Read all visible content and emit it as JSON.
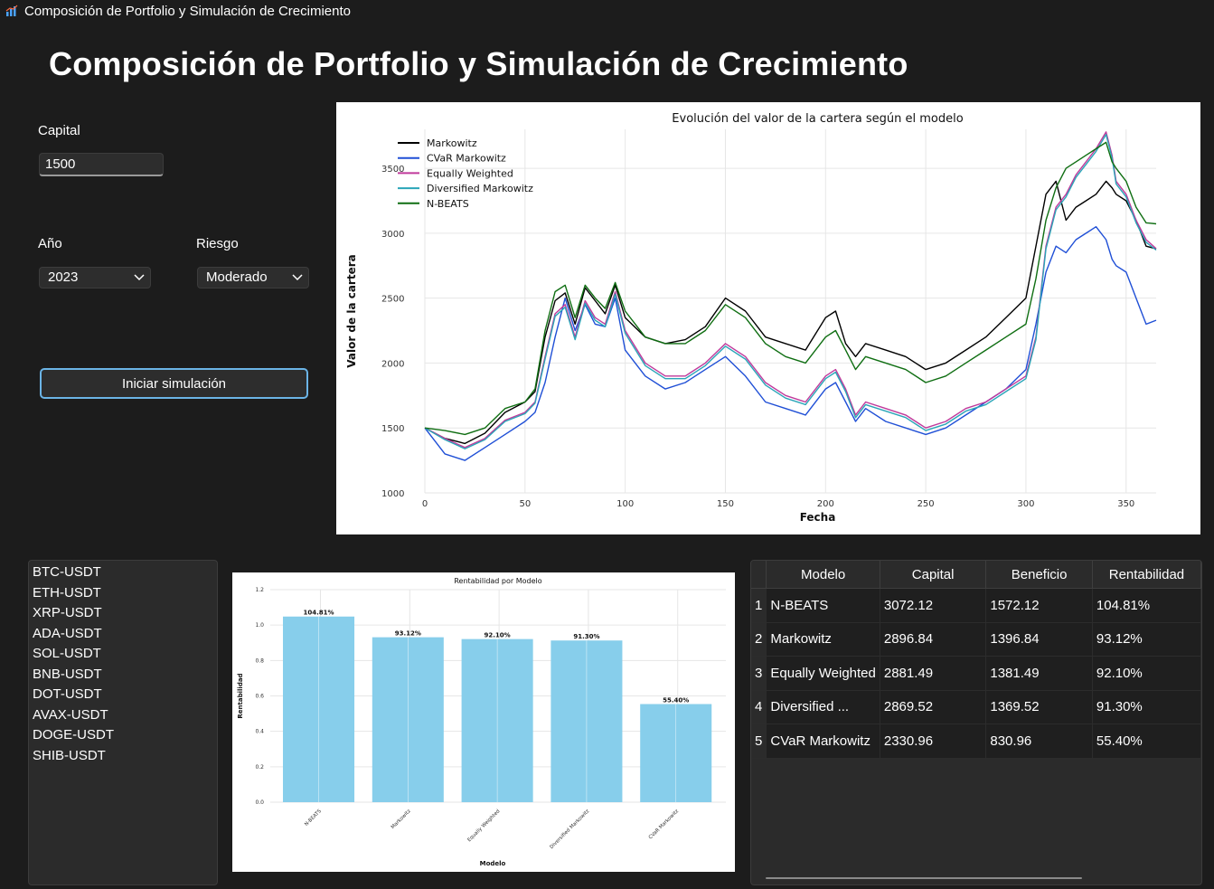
{
  "window": {
    "title": "Composición de Portfolio y Simulación de Crecimiento"
  },
  "header": {
    "title": "Composición de Portfolio y Simulación de Crecimiento"
  },
  "form": {
    "capital_label": "Capital",
    "capital_value": "1500",
    "year_label": "Año",
    "year_value": "2023",
    "risk_label": "Riesgo",
    "risk_value": "Moderado",
    "start_button": "Iniciar simulación"
  },
  "tickers": [
    "BTC-USDT",
    "ETH-USDT",
    "XRP-USDT",
    "ADA-USDT",
    "SOL-USDT",
    "BNB-USDT",
    "DOT-USDT",
    "AVAX-USDT",
    "DOGE-USDT",
    "SHIB-USDT"
  ],
  "results_table": {
    "columns": [
      "Modelo",
      "Capital",
      "Beneficio",
      "Rentabilidad"
    ],
    "rows": [
      {
        "index": "1",
        "model": "N-BEATS",
        "capital": "3072.12",
        "benefit": "1572.12",
        "return": "104.81%"
      },
      {
        "index": "2",
        "model": "Markowitz",
        "capital": "2896.84",
        "benefit": "1396.84",
        "return": "93.12%"
      },
      {
        "index": "3",
        "model": "Equally Weighted",
        "capital": "2881.49",
        "benefit": "1381.49",
        "return": "92.10%"
      },
      {
        "index": "4",
        "model": "Diversified ...",
        "capital": "2869.52",
        "benefit": "1369.52",
        "return": "91.30%"
      },
      {
        "index": "5",
        "model": "CVaR Markowitz",
        "capital": "2330.96",
        "benefit": "830.96",
        "return": "55.40%"
      }
    ]
  },
  "chart_data": [
    {
      "type": "line",
      "title": "Evolución del valor de la cartera según el modelo",
      "xlabel": "Fecha",
      "ylabel": "Valor de la cartera",
      "xlim": [
        0,
        365
      ],
      "ylim": [
        1000,
        3800
      ],
      "xticks": [
        0,
        50,
        100,
        150,
        200,
        250,
        300,
        350
      ],
      "yticks": [
        1000,
        1500,
        2000,
        2500,
        3000,
        3500
      ],
      "grid": true,
      "legend_position": "top-left",
      "x": [
        0,
        10,
        20,
        30,
        40,
        50,
        55,
        60,
        65,
        70,
        75,
        80,
        85,
        90,
        95,
        100,
        110,
        120,
        130,
        140,
        150,
        160,
        170,
        180,
        190,
        200,
        205,
        210,
        215,
        220,
        230,
        240,
        250,
        260,
        270,
        280,
        290,
        300,
        305,
        310,
        315,
        320,
        325,
        330,
        335,
        340,
        343,
        345,
        350,
        355,
        360,
        365
      ],
      "series": [
        {
          "name": "Markowitz",
          "color": "#000000",
          "values": [
            1500,
            1420,
            1380,
            1460,
            1620,
            1700,
            1780,
            2200,
            2480,
            2540,
            2300,
            2580,
            2480,
            2380,
            2600,
            2350,
            2200,
            2150,
            2180,
            2280,
            2500,
            2400,
            2200,
            2150,
            2100,
            2350,
            2400,
            2150,
            2050,
            2150,
            2100,
            2050,
            1950,
            2000,
            2100,
            2200,
            2350,
            2500,
            2900,
            3300,
            3400,
            3100,
            3200,
            3250,
            3300,
            3400,
            3350,
            3300,
            3250,
            3100,
            2900,
            2880
          ]
        },
        {
          "name": "CVaR Markowitz",
          "color": "#1f4fd6",
          "values": [
            1500,
            1300,
            1250,
            1350,
            1450,
            1550,
            1620,
            1850,
            2200,
            2500,
            2250,
            2450,
            2300,
            2280,
            2500,
            2100,
            1900,
            1800,
            1850,
            1950,
            2050,
            1900,
            1700,
            1650,
            1600,
            1800,
            1850,
            1700,
            1550,
            1650,
            1550,
            1500,
            1450,
            1500,
            1600,
            1700,
            1800,
            1950,
            2300,
            2700,
            2900,
            2850,
            2950,
            3000,
            3050,
            2950,
            2800,
            2750,
            2700,
            2500,
            2300,
            2330
          ]
        },
        {
          "name": "Equally Weighted",
          "color": "#c0399b",
          "values": [
            1500,
            1420,
            1350,
            1420,
            1560,
            1620,
            1700,
            2050,
            2380,
            2450,
            2200,
            2480,
            2350,
            2300,
            2550,
            2250,
            2000,
            1900,
            1900,
            2000,
            2150,
            2050,
            1850,
            1750,
            1700,
            1900,
            1950,
            1800,
            1600,
            1700,
            1650,
            1600,
            1500,
            1550,
            1650,
            1700,
            1800,
            1900,
            2200,
            2900,
            3200,
            3300,
            3450,
            3550,
            3650,
            3780,
            3600,
            3400,
            3300,
            3100,
            2950,
            2881
          ]
        },
        {
          "name": "Diversified Markowitz",
          "color": "#2aa5b8",
          "values": [
            1500,
            1410,
            1340,
            1410,
            1550,
            1610,
            1690,
            2030,
            2360,
            2430,
            2180,
            2460,
            2330,
            2280,
            2530,
            2230,
            1980,
            1880,
            1880,
            1980,
            2130,
            2030,
            1830,
            1730,
            1680,
            1880,
            1930,
            1780,
            1580,
            1680,
            1630,
            1580,
            1480,
            1530,
            1630,
            1680,
            1780,
            1880,
            2180,
            2880,
            3180,
            3280,
            3430,
            3530,
            3630,
            3760,
            3580,
            3380,
            3280,
            3080,
            2930,
            2870
          ]
        },
        {
          "name": "N-BEATS",
          "color": "#0f6e12",
          "values": [
            1500,
            1480,
            1450,
            1500,
            1650,
            1700,
            1800,
            2250,
            2550,
            2600,
            2350,
            2600,
            2500,
            2420,
            2620,
            2400,
            2200,
            2150,
            2150,
            2250,
            2450,
            2350,
            2150,
            2050,
            2000,
            2200,
            2250,
            2100,
            1950,
            2050,
            2000,
            1950,
            1850,
            1900,
            2000,
            2100,
            2200,
            2300,
            2650,
            3100,
            3350,
            3500,
            3550,
            3600,
            3650,
            3700,
            3550,
            3500,
            3400,
            3200,
            3080,
            3072
          ]
        }
      ]
    },
    {
      "type": "bar",
      "title": "Rentabilidad por Modelo",
      "xlabel": "Modelo",
      "ylabel": "Rentabilidad",
      "ylim": [
        0,
        1.2
      ],
      "yticks": [
        0.0,
        0.2,
        0.4,
        0.6,
        0.8,
        1.0,
        1.2
      ],
      "categories": [
        "N-BEATS",
        "Markowitz",
        "Equally Weighted",
        "Diversified Markowitz",
        "CVaR Markowitz"
      ],
      "values": [
        1.0481,
        0.9312,
        0.921,
        0.913,
        0.554
      ],
      "data_labels": [
        "104.81%",
        "93.12%",
        "92.10%",
        "91.30%",
        "55.40%"
      ],
      "bar_color": "#87ceeb",
      "grid": true
    }
  ]
}
